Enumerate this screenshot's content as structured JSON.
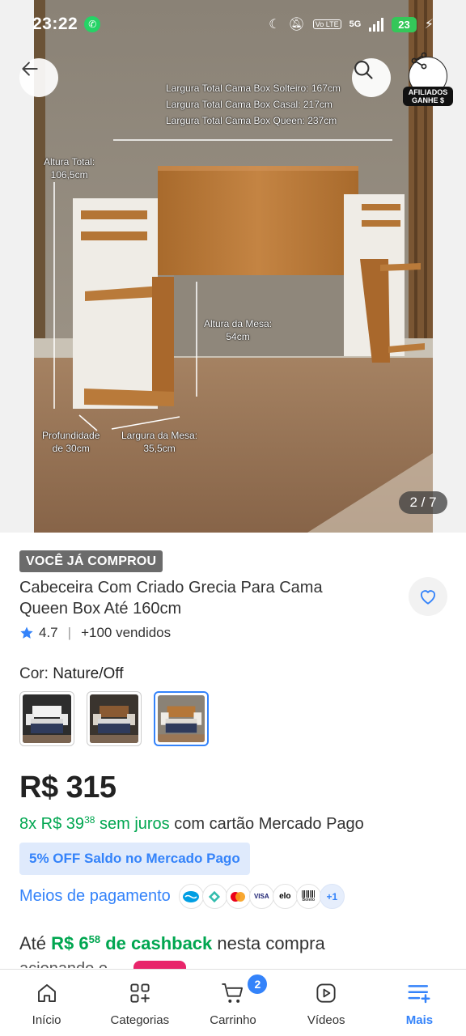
{
  "status_bar": {
    "time": "23:22",
    "battery": "23",
    "network": "5G",
    "volte": "Vo LTE"
  },
  "gallery": {
    "counter": "2 / 7"
  },
  "dimensions": {
    "width_single": "Largura Total Cama Box Solteiro: 167cm",
    "width_double": "Largura Total Cama Box Casal: 217cm",
    "width_queen": "Largura Total Cama Box Queen: 237cm",
    "total_height_label": "Altura Total:",
    "total_height_value": "106,5cm",
    "table_height_label": "Altura da Mesa:",
    "table_height_value": "54cm",
    "depth_label": "Profundidade",
    "depth_value": "de 30cm",
    "table_width_label": "Largura da Mesa:",
    "table_width_value": "35,5cm"
  },
  "affiliate": {
    "line1": "AFILIADOS",
    "line2": "GANHE $"
  },
  "product": {
    "badge": "VOCÊ JÁ COMPROU",
    "title": "Cabeceira Com Criado Grecia Para Cama Queen Box Até 160cm",
    "rating": "4.7",
    "sold": "+100 vendidos",
    "color_label": "Cor: ",
    "color_value": "Nature/Off",
    "price": "R$ 315",
    "installments_prefix": "8x R$ 39",
    "installments_cents": "38",
    "installments_interest": " sem juros",
    "installments_suffix": " com cartão Mercado Pago",
    "discount_badge": "5% OFF Saldo no Mercado Pago",
    "payment_link": "Meios de pagamento",
    "payment_more": "+1",
    "cashback_prefix": "Até ",
    "cashback_amount": "R$ 6",
    "cashback_cents": "58",
    "cashback_mid": " de cashback",
    "cashback_suffix": " nesta compra",
    "cut_text": "acionando o"
  },
  "payment_methods": [
    {
      "name": "mercado-pago",
      "label": "MP"
    },
    {
      "name": "pix",
      "label": ""
    },
    {
      "name": "mastercard",
      "label": ""
    },
    {
      "name": "visa",
      "label": "VISA"
    },
    {
      "name": "elo",
      "label": "elo"
    },
    {
      "name": "boleto",
      "label": "Boleto"
    }
  ],
  "nav": {
    "home": "Início",
    "categories": "Categorias",
    "cart": "Carrinho",
    "cart_count": "2",
    "videos": "Vídeos",
    "more": "Mais"
  },
  "colors": {
    "accent": "#3483fa",
    "green": "#00a650",
    "badge_grey": "#6b6b6b",
    "pink": "#e8256a"
  }
}
